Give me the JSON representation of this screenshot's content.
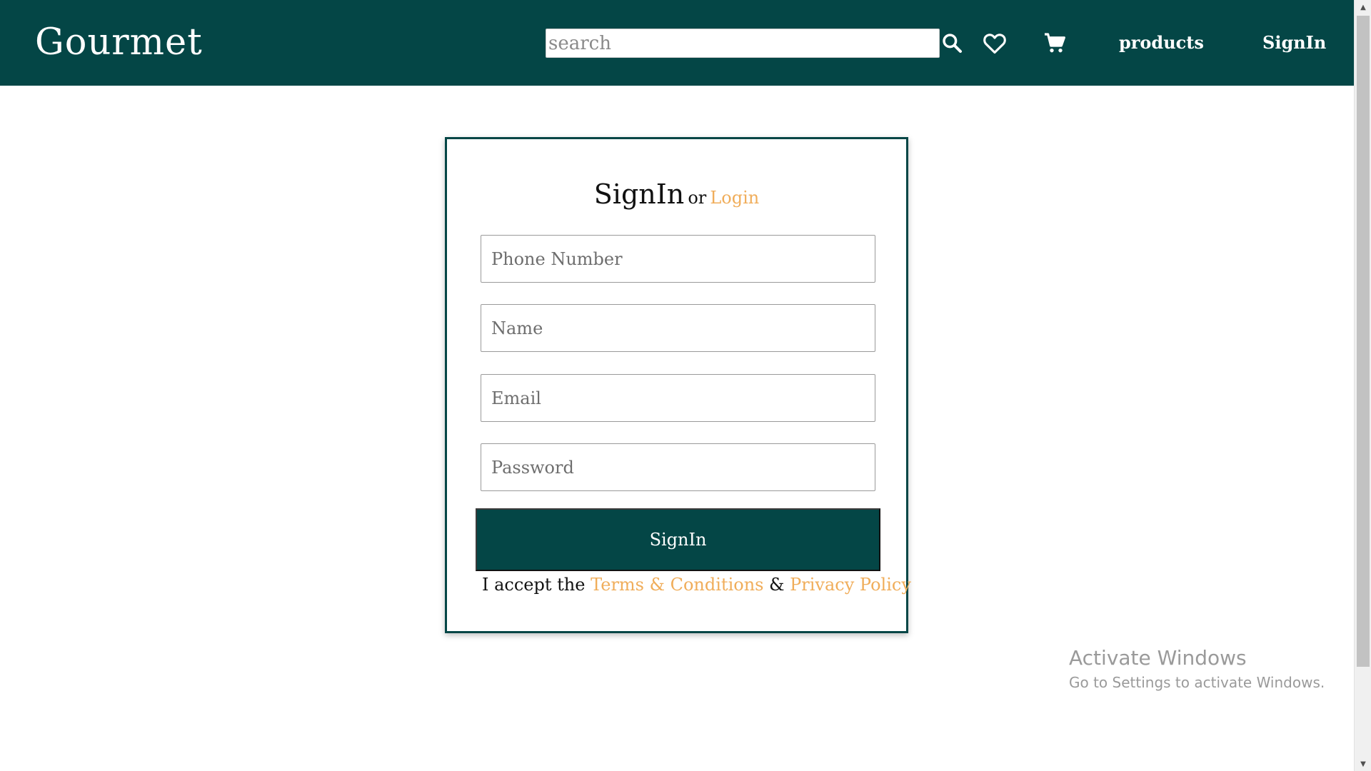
{
  "colors": {
    "brand": "#044646",
    "accent": "#f0ad5a",
    "background": "#ffffff"
  },
  "header": {
    "brand": "Gourmet",
    "search_placeholder": "search",
    "icons": [
      "search-icon",
      "heart-icon",
      "cart-icon"
    ],
    "nav": {
      "products": "products",
      "signin": "SignIn"
    }
  },
  "form": {
    "title": "SignIn",
    "or": "or",
    "login_link": "Login",
    "fields": {
      "phone_placeholder": "Phone Number",
      "name_placeholder": "Name",
      "email_placeholder": "Email",
      "password_placeholder": "Password"
    },
    "submit_label": "SignIn",
    "terms": {
      "prefix": "I accept the",
      "terms_link": "Terms & Conditions",
      "amp": "&",
      "privacy_link": "Privacy Policy"
    }
  },
  "watermark": {
    "title": "Activate Windows",
    "subtitle": "Go to Settings to activate Windows."
  }
}
